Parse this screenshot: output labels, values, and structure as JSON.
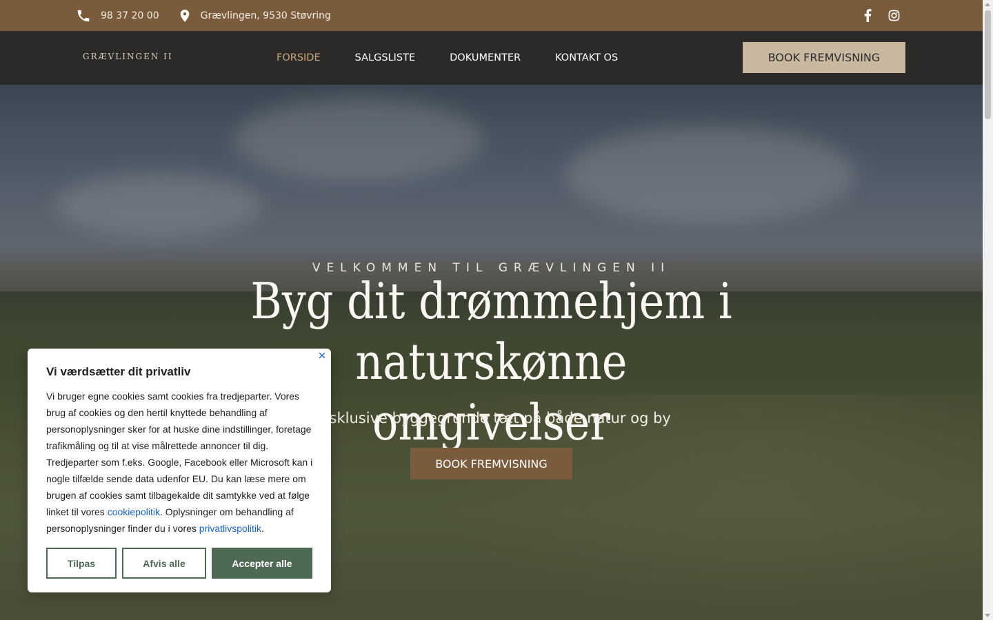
{
  "topbar": {
    "phone": "98 37 20 00",
    "address": "Grævlingen, 9530 Støvring",
    "phone_icon": "phone-icon",
    "address_icon": "map-marker-icon",
    "social": [
      "facebook-icon",
      "instagram-icon"
    ]
  },
  "navbar": {
    "logo": "GRÆVLINGEN II",
    "items": [
      {
        "label": "FORSIDE",
        "active": true
      },
      {
        "label": "SALGSLISTE",
        "active": false
      },
      {
        "label": "DOKUMENTER",
        "active": false
      },
      {
        "label": "KONTAKT OS",
        "active": false
      }
    ],
    "cta": "BOOK FREMVISNING"
  },
  "hero": {
    "eyebrow": "VELKOMMEN TIL GRÆVLINGEN II",
    "headline": "Byg dit drømmehjem i naturskønne omgivelser",
    "subline": "Eksklusive byggegrunde tæt på både natur og by",
    "cta": "BOOK FREMVISNING"
  },
  "cookie": {
    "title": "Vi værdsætter dit privatliv",
    "text_1": "Vi bruger egne cookies samt cookies fra tredjeparter. Vores brug af cookies og den hertil knyttede behandling af personoplysninger sker for at huske dine indstillinger, foretage trafikmåling og til at vise målrettede annoncer til dig. Tredjeparter som f.eks. Google, Facebook eller Microsoft kan i nogle tilfælde sende data udenfor EU.  Du kan læse mere om brugen af cookies samt tilbagekalde dit samtykke ved at følge linket til vores ",
    "link_cookie": "cookiepolitik",
    "text_2": ". Oplysninger om behandling af personoplysninger finder du i vores ",
    "link_privacy": "privatlivspolitik",
    "text_3": ".",
    "btn_customize": "Tilpas",
    "btn_reject": "Afvis alle",
    "btn_accept": "Accepter alle"
  },
  "colors": {
    "topbar": "#7a5c3c",
    "navbar": "#2b2a28",
    "nav_active": "#c9a97e",
    "nav_cta": "#c8b8a0",
    "cookie_green": "#4e6a55",
    "link_blue": "#1863dc"
  }
}
